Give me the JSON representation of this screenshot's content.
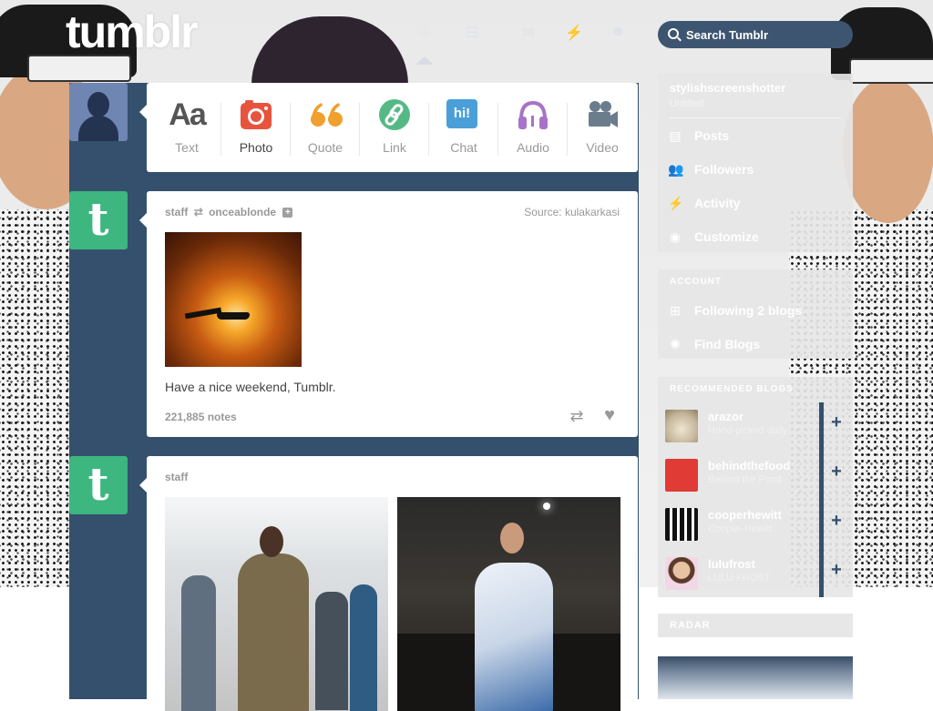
{
  "header": {
    "logo": "tumblr",
    "search_placeholder": "Search Tumblr",
    "nav_icons": [
      "home-icon",
      "inbox-icon",
      "messages-icon",
      "activity-icon",
      "account-icon"
    ]
  },
  "post_types": [
    {
      "label": "Text",
      "icon": "text-icon"
    },
    {
      "label": "Photo",
      "icon": "photo-icon"
    },
    {
      "label": "Quote",
      "icon": "quote-icon"
    },
    {
      "label": "Link",
      "icon": "link-icon"
    },
    {
      "label": "Chat",
      "icon": "chat-icon"
    },
    {
      "label": "Audio",
      "icon": "audio-icon"
    },
    {
      "label": "Video",
      "icon": "video-icon"
    }
  ],
  "post_type_icons": {
    "text": "Aa",
    "chat": "hi!"
  },
  "post1": {
    "author": "staff",
    "reblogged_from": "onceablonde",
    "source_label": "Source:",
    "source_name": "kulakarkasi",
    "caption": "Have a nice weekend, Tumblr.",
    "notes": "221,885 notes"
  },
  "post2": {
    "author": "staff"
  },
  "sidebar": {
    "blog_name": "stylishscreenshotter",
    "blog_sub": "Untitled",
    "blog_items": [
      {
        "label": "Posts",
        "icon": "posts-icon"
      },
      {
        "label": "Followers",
        "icon": "followers-icon"
      },
      {
        "label": "Activity",
        "icon": "activity-icon"
      },
      {
        "label": "Customize",
        "icon": "customize-icon"
      }
    ],
    "account_title": "ACCOUNT",
    "account_items": [
      {
        "label": "Following 2 blogs",
        "icon": "following-icon"
      },
      {
        "label": "Find Blogs",
        "icon": "find-blogs-icon"
      }
    ],
    "recommended_title": "RECOMMENDED BLOGS",
    "recommended": [
      {
        "name": "arazor",
        "sub": "Hand-picked daily"
      },
      {
        "name": "behindthefood",
        "sub": "Behind the Food"
      },
      {
        "name": "cooperhewitt",
        "sub": "Cooper-Hewitt"
      },
      {
        "name": "lulufrost",
        "sub": "LULU FROST"
      }
    ],
    "radar_title": "RADAR"
  },
  "colors": {
    "dashboard_blue": "#34506d",
    "search_bg": "#3d5571",
    "photo_icon": "#e8533d",
    "quote_icon": "#f0a02e",
    "link_icon": "#56b985",
    "chat_icon": "#4a9fd8",
    "audio_icon": "#a773c8",
    "video_icon": "#6b7c8c",
    "tumblr_green": "#3db680"
  }
}
